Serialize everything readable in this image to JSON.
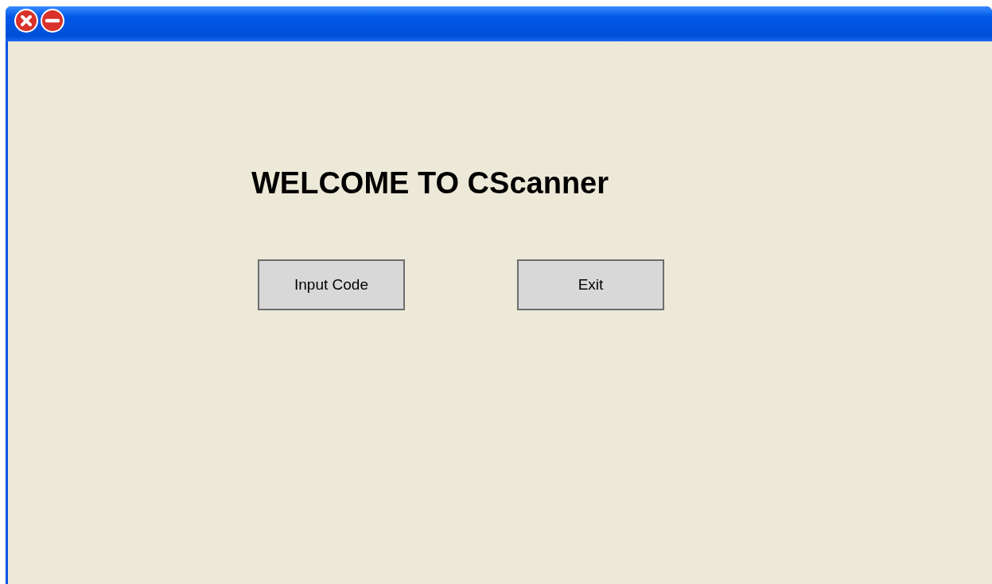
{
  "heading": "WELCOME TO CScanner",
  "buttons": [
    {
      "label": "Input Code"
    },
    {
      "label": "Exit"
    }
  ]
}
